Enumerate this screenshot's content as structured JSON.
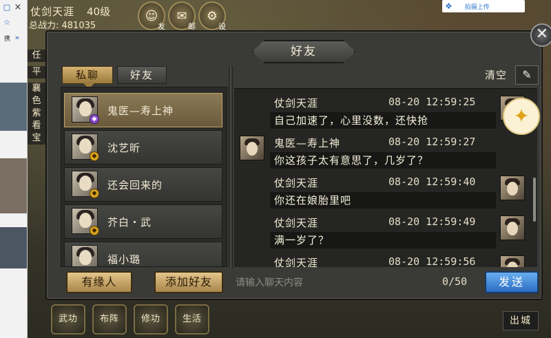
{
  "browser": {
    "icons": [
      "square-icon",
      "close-icon",
      "star-icon",
      "double-chevron-icon"
    ],
    "close_glyph": "×",
    "restore_glyph": "□",
    "star_glyph": "☆",
    "chev_glyph": "»",
    "mini_text": "携"
  },
  "hud": {
    "player_name": "仗剑天涯",
    "level": "40级",
    "power": "总战力: 481035",
    "mail_label": "邮",
    "friend_label": "友",
    "settings_label": "设",
    "top_badge": "拍摄上传"
  },
  "left_stub": [
    "任",
    "平",
    "襄",
    "色",
    "紫",
    "看",
    "宝"
  ],
  "dialog": {
    "title": "好友",
    "close_glyph": "✕",
    "tabs": {
      "private_chat": "私聊",
      "friends": "好友"
    },
    "clear_label": "清空",
    "eraser_glyph": "✎"
  },
  "contacts": [
    {
      "name": "鬼医—寿上神",
      "badge": "◆",
      "badge_color": "purple",
      "active": true
    },
    {
      "name": "沈艺昕",
      "badge": "◆",
      "badge_color": "gold",
      "active": false
    },
    {
      "name": "还会回来的",
      "badge": "◆",
      "badge_color": "gold",
      "active": false
    },
    {
      "name": "芥白・武",
      "badge": "◆",
      "badge_color": "gold",
      "active": false
    },
    {
      "name": "福小璐",
      "badge": "",
      "badge_color": "gold",
      "active": false
    }
  ],
  "messages": [
    {
      "sender": "仗剑天涯",
      "time": "08-20 12:59:25",
      "text": "自己加速了，心里没数，还快抢",
      "side": "right"
    },
    {
      "sender": "鬼医—寿上神",
      "time": "08-20 12:59:27",
      "text": "你这孩子太有意思了，几岁了？",
      "side": "left"
    },
    {
      "sender": "仗剑天涯",
      "time": "08-20 12:59:40",
      "text": "你还在娘胎里吧",
      "side": "right"
    },
    {
      "sender": "仗剑天涯",
      "time": "08-20 12:59:49",
      "text": "满一岁了？",
      "side": "right"
    },
    {
      "sender": "仗剑天涯",
      "time": "08-20 12:59:56",
      "text": "",
      "side": "right"
    }
  ],
  "bottom": {
    "fate_button": "有缘人",
    "add_friend_button": "添加好友",
    "input_placeholder": "请输入聊天内容",
    "char_count": "0/50",
    "send_button": "发送"
  },
  "nav": {
    "items": [
      "武功",
      "布阵",
      "修功",
      "生活"
    ],
    "exit_city": "出城"
  },
  "colors": {
    "accent_gold": "#d4b170",
    "send_blue": "#2a6dc2",
    "dialog_bg": "#3a3b37"
  }
}
